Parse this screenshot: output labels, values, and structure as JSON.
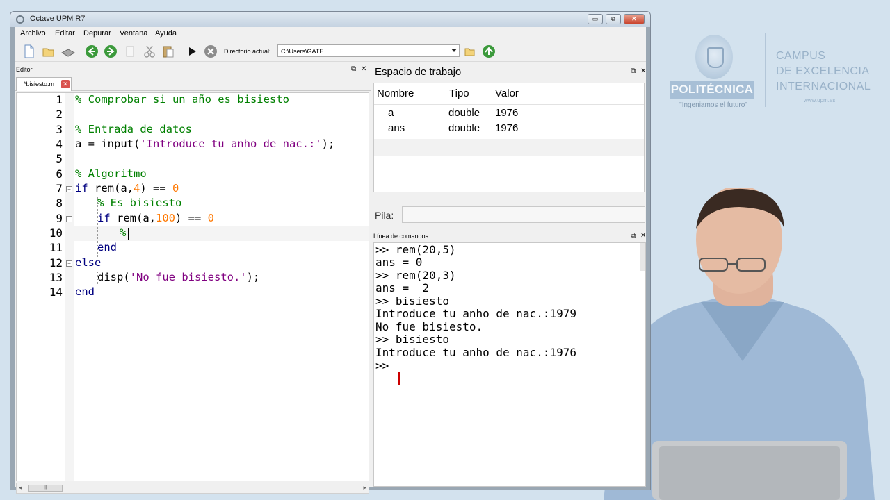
{
  "window": {
    "title": "Octave UPM R7",
    "minimize": "▭",
    "maximize": "⧉",
    "close": "✕"
  },
  "menu": [
    "Archivo",
    "Editar",
    "Depurar",
    "Ventana",
    "Ayuda"
  ],
  "toolbar": {
    "icons": [
      "new-file-icon",
      "open-folder-icon",
      "save-icon",
      "back-icon",
      "forward-icon",
      "copy-icon",
      "cut-icon",
      "paste-icon",
      "run-icon",
      "stop-icon",
      "browse-folder-icon",
      "go-up-icon"
    ],
    "directory_label": "Directorio actual:",
    "directory_value": "C:\\Users\\GATE"
  },
  "editor": {
    "title": "Editor",
    "tab": "*bisiesto.m",
    "line_numbers": [
      "1",
      "2",
      "3",
      "4",
      "5",
      "6",
      "7",
      "8",
      "9",
      "10",
      "11",
      "12",
      "13",
      "14"
    ],
    "lines": {
      "l1": "% Comprobar si un año es bisiesto",
      "l3": "% Entrada de datos",
      "l4_a": "a = input(",
      "l4_s": "'Introduce tu anho de nac.:'",
      "l4_b": ");",
      "l6": "% Algoritmo",
      "l7_kw": "if",
      "l7_a": " rem(a,",
      "l7_n": "4",
      "l7_b": ") == ",
      "l7_n2": "0",
      "l8": "% Es bisiesto",
      "l9_kw": "if",
      "l9_a": " rem(a,",
      "l9_n": "100",
      "l9_b": ") == ",
      "l9_n2": "0",
      "l10": "%",
      "l11": "end",
      "l12": "else",
      "l13_a": "disp(",
      "l13_s": "'No fue bisiesto.'",
      "l13_b": ");",
      "l14": "end"
    }
  },
  "workspace": {
    "title": "Espacio de trabajo",
    "columns": [
      "Nombre",
      "Tipo",
      "Valor"
    ],
    "rows": [
      {
        "name": "a",
        "type": "double",
        "value": "1976"
      },
      {
        "name": "ans",
        "type": "double",
        "value": "1976"
      }
    ]
  },
  "stack": {
    "label": "Pila:"
  },
  "command_window": {
    "title": "Línea de comandos",
    "lines": [
      ">> rem(20,5)",
      "ans = 0",
      ">> rem(20,3)",
      "ans =  2",
      ">> bisiesto",
      "Introduce tu anho de nac.:1979",
      "No fue bisiesto.",
      ">> bisiesto",
      "Introduce tu anho de nac.:1976",
      ">> "
    ]
  },
  "background": {
    "badge": "POLITÉCNICA",
    "slogan": "\"Ingeniamos el futuro\"",
    "campus_lines": [
      "CAMPUS",
      "DE EXCELENCIA",
      "INTERNACIONAL"
    ],
    "url": "www.upm.es"
  },
  "colors": {
    "comment": "#008000",
    "keyword": "#000080",
    "string": "#800080",
    "number": "#ff7800",
    "cursor": "#cc0000"
  }
}
